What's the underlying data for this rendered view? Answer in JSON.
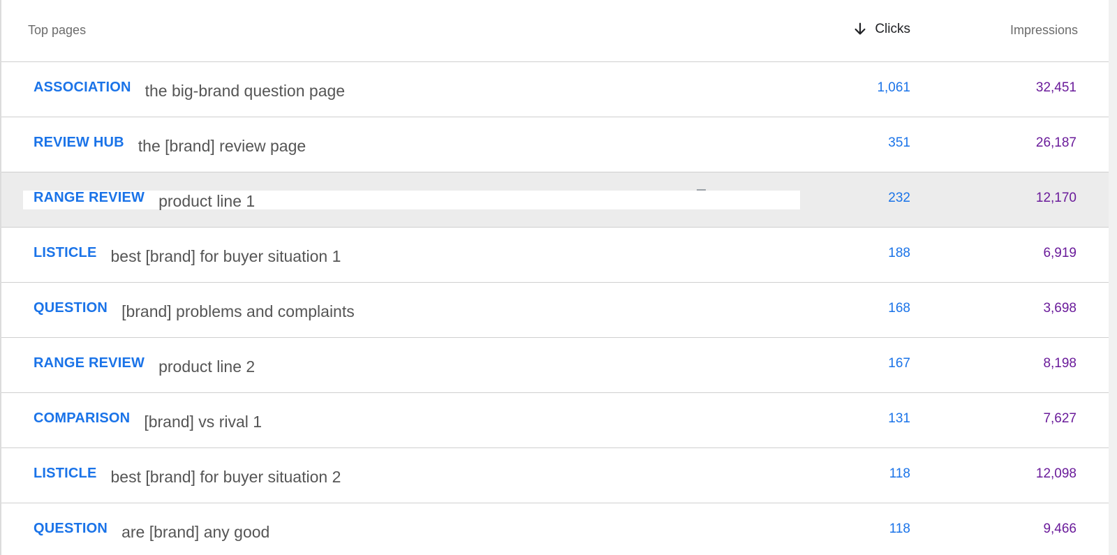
{
  "table": {
    "header": {
      "title": "Top pages",
      "clicks_label": "Clicks",
      "impressions_label": "Impressions",
      "sort_icon": "arrow-down-icon"
    },
    "rows": [
      {
        "tag": "ASSOCIATION",
        "page": "the big-brand question page",
        "clicks": "1,061",
        "impressions": "32,451"
      },
      {
        "tag": "REVIEW HUB",
        "page": "the [brand] review page",
        "clicks": "351",
        "impressions": "26,187"
      },
      {
        "tag": "RANGE REVIEW",
        "page": "product line 1",
        "clicks": "232",
        "impressions": "12,170",
        "highlighted": true
      },
      {
        "tag": "LISTICLE",
        "page": "best [brand] for buyer situation 1",
        "clicks": "188",
        "impressions": "6,919"
      },
      {
        "tag": "QUESTION",
        "page": "[brand] problems and complaints",
        "clicks": "168",
        "impressions": "3,698"
      },
      {
        "tag": "RANGE REVIEW",
        "page": "product line 2",
        "clicks": "167",
        "impressions": "8,198"
      },
      {
        "tag": "COMPARISON",
        "page": "[brand] vs rival 1",
        "clicks": "131",
        "impressions": "7,627"
      },
      {
        "tag": "LISTICLE",
        "page": "best [brand] for buyer situation 2",
        "clicks": "118",
        "impressions": "12,098"
      },
      {
        "tag": "QUESTION",
        "page": "are [brand] any good",
        "clicks": "118",
        "impressions": "9,466"
      }
    ]
  },
  "colors": {
    "tag": "#1a73e8",
    "clicks": "#1a73e8",
    "impressions": "#6a1b9a",
    "highlight_row": "#ececec"
  }
}
